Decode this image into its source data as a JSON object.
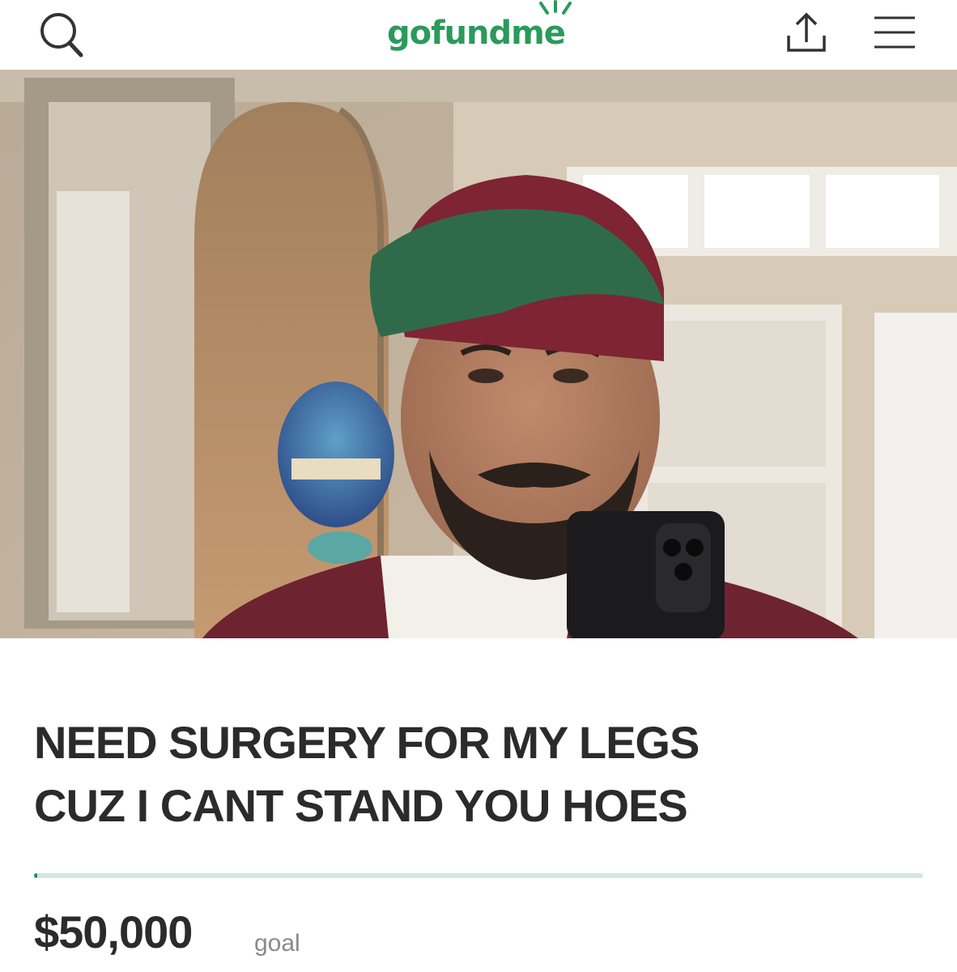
{
  "header": {
    "logo_text": "gofundme",
    "search_icon": "search-icon",
    "share_icon": "share-icon",
    "menu_icon": "hamburger-menu-icon"
  },
  "campaign": {
    "title_line1": "NEED SURGERY FOR MY LEGS",
    "title_line2": "CUZ I CANT STAND YOU HOES",
    "progress_fraction": 0.004,
    "goal_amount": "$50,000",
    "goal_label": "goal"
  },
  "colors": {
    "brand_green": "#2b9a5c",
    "progress_fill": "#1f8c63",
    "progress_track": "#d3e6e2",
    "title_text": "#2b2b2b",
    "muted_text": "#8a8a8a"
  }
}
